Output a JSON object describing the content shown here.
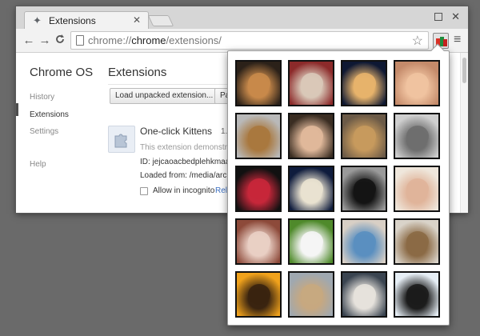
{
  "tab": {
    "title": "Extensions",
    "close": "✕"
  },
  "window": {
    "minimize_maximize": "",
    "close": "✕"
  },
  "toolbar": {
    "back": "←",
    "forward": "→",
    "reload": "C",
    "url_scheme": "chrome://",
    "url_host": "chrome",
    "url_path": "/extensions/",
    "star": "☆",
    "menu": "≡"
  },
  "sidebar": {
    "brand": "Chrome OS",
    "items": [
      {
        "label": "History"
      },
      {
        "label": "Extensions"
      },
      {
        "label": "Settings"
      },
      {
        "label": "Help"
      }
    ]
  },
  "main": {
    "title": "Extensions",
    "buttons": {
      "load_unpacked": "Load unpacked extension...",
      "pack": "Pa"
    },
    "extension": {
      "name": "One-click Kittens",
      "version": "1.",
      "description": "This extension demonstr",
      "id": "ID: jejcaoacbedplehkmaap",
      "loaded_from": "Loaded from: /media/archi",
      "allow_incognito": "Allow in incognito",
      "reload_link": "Rel"
    }
  },
  "popup": {
    "kittens": [
      {
        "name": "kitten-photo-1"
      },
      {
        "name": "kitten-photo-2"
      },
      {
        "name": "kitten-photo-3"
      },
      {
        "name": "kitten-photo-4"
      },
      {
        "name": "kitten-photo-5"
      },
      {
        "name": "kitten-photo-6"
      },
      {
        "name": "kitten-photo-7"
      },
      {
        "name": "kitten-photo-8"
      },
      {
        "name": "kitten-photo-9"
      },
      {
        "name": "kitten-photo-10"
      },
      {
        "name": "kitten-photo-11"
      },
      {
        "name": "kitten-photo-12"
      },
      {
        "name": "kitten-photo-13"
      },
      {
        "name": "kitten-photo-14"
      },
      {
        "name": "kitten-photo-15"
      },
      {
        "name": "kitten-photo-16"
      },
      {
        "name": "kitten-photo-17"
      },
      {
        "name": "kitten-photo-18"
      },
      {
        "name": "kitten-photo-19"
      },
      {
        "name": "kitten-photo-20"
      }
    ]
  },
  "colors": {
    "accent": "#3b6fc2",
    "background": "#6a6a6a"
  }
}
